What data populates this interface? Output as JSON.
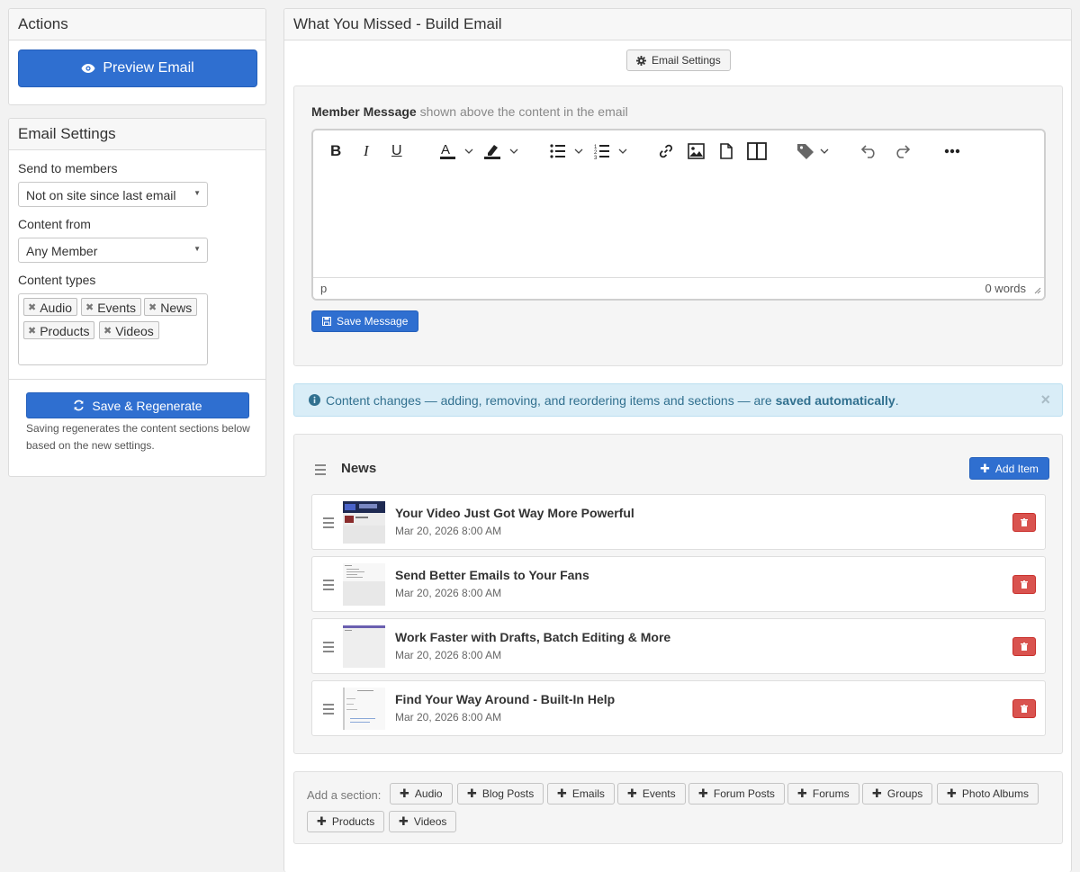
{
  "sidebar": {
    "actions": {
      "title": "Actions",
      "preview_label": "Preview Email",
      "preview_icon": "eye-icon"
    },
    "email_settings": {
      "title": "Email Settings",
      "send_to_label": "Send to members",
      "send_to_value": "Not on site since last email",
      "content_from_label": "Content from",
      "content_from_value": "Any Member",
      "content_types_label": "Content types",
      "content_types": [
        "Audio",
        "Events",
        "News",
        "Products",
        "Videos"
      ],
      "regenerate_label": "Save & Regenerate",
      "regenerate_icon": "refresh-icon",
      "regenerate_note": "Saving regenerates the content sections below based on the new settings."
    }
  },
  "main": {
    "title": "What You Missed - Build Email",
    "email_settings_button": "Email Settings",
    "member_message": {
      "label": "Member Message",
      "hint": "shown above the content in the email",
      "status_path": "p",
      "word_count": "0 words",
      "save_label": "Save Message"
    },
    "toolbar": [
      "bold-icon",
      "italic-icon",
      "underline-icon",
      "text-color-icon",
      "highlight-icon",
      "bullet-list-icon",
      "numbered-list-icon",
      "link-icon",
      "image-icon",
      "file-icon",
      "columns-icon",
      "tag-icon",
      "undo-icon",
      "redo-icon",
      "more-icon"
    ],
    "alert": {
      "text_before": "Content changes — adding, removing, and reordering items and sections — are ",
      "text_bold": "saved automatically",
      "text_after": ".",
      "close": "×"
    },
    "news_section": {
      "title": "News",
      "add_item_label": "Add Item",
      "items": [
        {
          "title": "Your Video Just Got Way More Powerful",
          "date": "Mar 20, 2026 8:00 AM"
        },
        {
          "title": "Send Better Emails to Your Fans",
          "date": "Mar 20, 2026 8:00 AM"
        },
        {
          "title": "Work Faster with Drafts, Batch Editing & More",
          "date": "Mar 20, 2026 8:00 AM"
        },
        {
          "title": "Find Your Way Around - Built-In Help",
          "date": "Mar 20, 2026 8:00 AM"
        }
      ]
    },
    "add_section": {
      "label": "Add a section:",
      "options": [
        "Audio",
        "Blog Posts",
        "Emails",
        "Events",
        "Forum Posts",
        "Forums",
        "Groups",
        "Photo Albums",
        "Products",
        "Videos"
      ]
    }
  },
  "colors": {
    "primary": "#2f6fd0",
    "danger": "#d9534f",
    "info_bg": "#d9edf7",
    "info_text": "#31708f"
  }
}
